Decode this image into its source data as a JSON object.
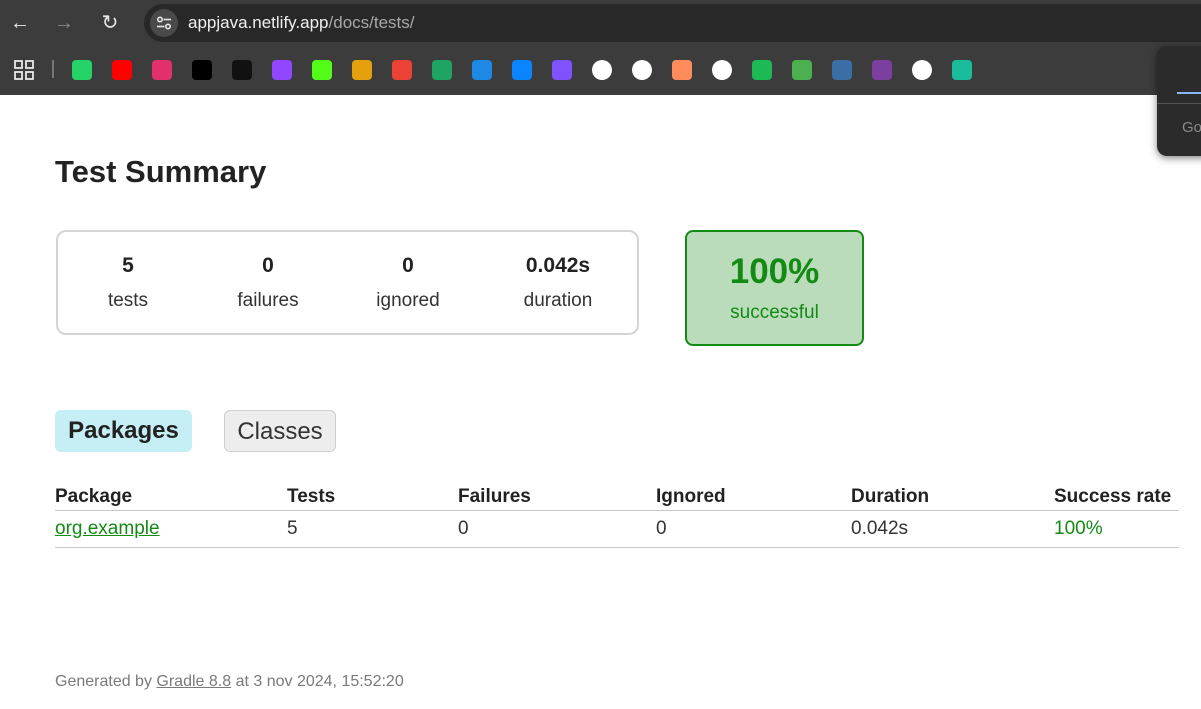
{
  "browser": {
    "url_host": "appjava.netlify.app",
    "url_path": "/docs/tests/",
    "popup_text": "Go",
    "bookmarks": [
      {
        "name": "whatsapp-icon",
        "color": "#25d366"
      },
      {
        "name": "youtube-icon",
        "color": "#ff0000"
      },
      {
        "name": "instagram-icon",
        "color": "#e1306c"
      },
      {
        "name": "x-icon",
        "color": "#000000"
      },
      {
        "name": "tiktok-icon",
        "color": "#111111"
      },
      {
        "name": "twitch-icon",
        "color": "#9146ff"
      },
      {
        "name": "kick-icon",
        "color": "#53fc18"
      },
      {
        "name": "plex-icon",
        "color": "#e5a00d"
      },
      {
        "name": "gmail-icon",
        "color": "#ea4335"
      },
      {
        "name": "google-drive-icon",
        "color": "#1fa463"
      },
      {
        "name": "classroom-icon",
        "color": "#1e88e5"
      },
      {
        "name": "mail-icon",
        "color": "#0a84ff"
      },
      {
        "name": "kotlin-icon",
        "color": "#7f52ff"
      },
      {
        "name": "github-icon",
        "color": "#ffffff"
      },
      {
        "name": "chatgpt-icon",
        "color": "#ffffff"
      },
      {
        "name": "copilot-icon",
        "color": "#ff8c5a"
      },
      {
        "name": "check-circle-icon",
        "color": "#ffffff"
      },
      {
        "name": "wattpad-w-icon",
        "color": "#1db954"
      },
      {
        "name": "leaf-icon",
        "color": "#4caf50"
      },
      {
        "name": "blue-circle-icon",
        "color": "#3a6ea5"
      },
      {
        "name": "w-circle-icon",
        "color": "#7b3fa0"
      },
      {
        "name": "github-icon-2",
        "color": "#ffffff"
      },
      {
        "name": "diamond-icon",
        "color": "#1abc9c"
      }
    ]
  },
  "page": {
    "title": "Test Summary",
    "counters": [
      {
        "value": "5",
        "label": "tests"
      },
      {
        "value": "0",
        "label": "failures"
      },
      {
        "value": "0",
        "label": "ignored"
      },
      {
        "value": "0.042s",
        "label": "duration"
      }
    ],
    "success": {
      "value": "100%",
      "label": "successful",
      "color": "#138a13"
    },
    "tabs": [
      {
        "label": "Packages",
        "active": true
      },
      {
        "label": "Classes",
        "active": false
      }
    ],
    "table": {
      "headers": [
        "Package",
        "Tests",
        "Failures",
        "Ignored",
        "Duration",
        "Success rate"
      ],
      "rows": [
        {
          "package": "org.example",
          "tests": "5",
          "failures": "0",
          "ignored": "0",
          "duration": "0.042s",
          "success_rate": "100%"
        }
      ]
    },
    "footer": {
      "prefix": "Generated by",
      "link": "Gradle 8.8",
      "suffix": "at 3 nov 2024, 15:52:20"
    }
  }
}
